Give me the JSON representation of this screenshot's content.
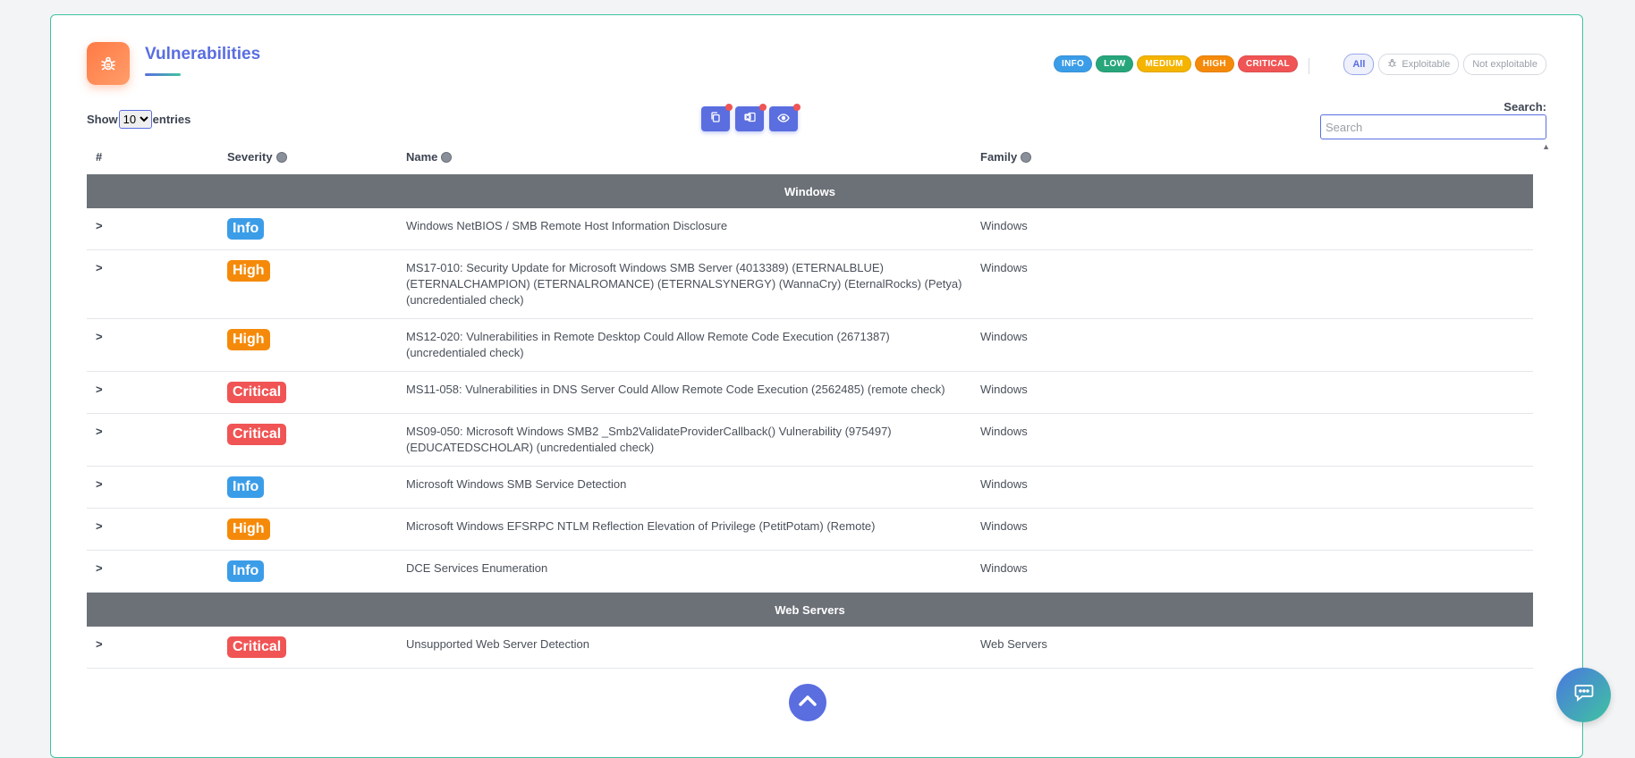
{
  "header": {
    "title": "Vulnerabilities"
  },
  "severity_filters": [
    {
      "label": "INFO",
      "color": "#3b9de8"
    },
    {
      "label": "LOW",
      "color": "#27a67a"
    },
    {
      "label": "MEDIUM",
      "color": "#f4b400"
    },
    {
      "label": "HIGH",
      "color": "#f58a0a"
    },
    {
      "label": "CRITICAL",
      "color": "#f05454"
    }
  ],
  "exploit_filters": {
    "all": "All",
    "exploitable": "Exploitable",
    "not_exploitable": "Not exploitable"
  },
  "controls": {
    "show_label": "Show",
    "entries_label": "entries",
    "page_size": "10",
    "search_label": "Search:",
    "search_placeholder": "Search"
  },
  "table": {
    "columns": {
      "index": "#",
      "severity": "Severity",
      "name": "Name",
      "family": "Family"
    },
    "groups": [
      {
        "title": "Windows",
        "rows": [
          {
            "severity": "Info",
            "color": "#3b9de8",
            "name": "Windows NetBIOS / SMB Remote Host Information Disclosure",
            "family": "Windows"
          },
          {
            "severity": "High",
            "color": "#f58a0a",
            "name": "MS17-010: Security Update for Microsoft Windows SMB Server (4013389) (ETERNALBLUE) (ETERNALCHAMPION) (ETERNALROMANCE) (ETERNALSYNERGY) (WannaCry) (EternalRocks) (Petya) (uncredentialed check)",
            "family": "Windows"
          },
          {
            "severity": "High",
            "color": "#f58a0a",
            "name": "MS12-020: Vulnerabilities in Remote Desktop Could Allow Remote Code Execution (2671387) (uncredentialed check)",
            "family": "Windows"
          },
          {
            "severity": "Critical",
            "color": "#f05454",
            "name": "MS11-058: Vulnerabilities in DNS Server Could Allow Remote Code Execution (2562485) (remote check)",
            "family": "Windows"
          },
          {
            "severity": "Critical",
            "color": "#f05454",
            "name": "MS09-050: Microsoft Windows SMB2 _Smb2ValidateProviderCallback() Vulnerability (975497) (EDUCATEDSCHOLAR) (uncredentialed check)",
            "family": "Windows"
          },
          {
            "severity": "Info",
            "color": "#3b9de8",
            "name": "Microsoft Windows SMB Service Detection",
            "family": "Windows"
          },
          {
            "severity": "High",
            "color": "#f58a0a",
            "name": "Microsoft Windows EFSRPC NTLM Reflection Elevation of Privilege (PetitPotam) (Remote)",
            "family": "Windows"
          },
          {
            "severity": "Info",
            "color": "#3b9de8",
            "name": "DCE Services Enumeration",
            "family": "Windows"
          }
        ]
      },
      {
        "title": "Web Servers",
        "rows": [
          {
            "severity": "Critical",
            "color": "#f05454",
            "name": "Unsupported Web Server Detection",
            "family": "Web Servers"
          }
        ]
      }
    ]
  },
  "icons": {
    "header": "bug-icon",
    "copy": "copy-icon",
    "excel": "excel-icon",
    "view": "eye-icon",
    "expand": "chevron-right-icon",
    "scroll_top": "chevron-up-icon",
    "chat": "chat-icon"
  }
}
